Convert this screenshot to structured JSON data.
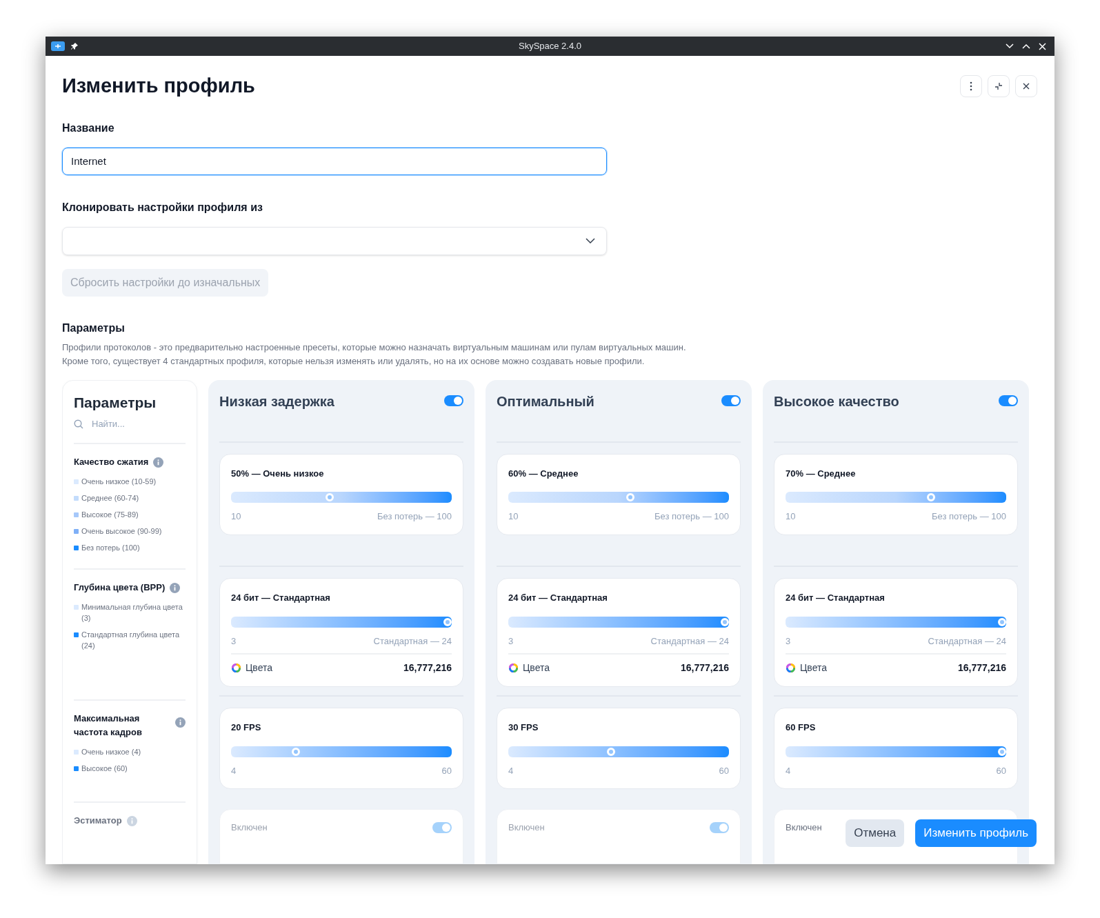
{
  "window": {
    "title": "SkySpace 2.4.0"
  },
  "page": {
    "title": "Изменить профиль"
  },
  "name_field": {
    "label": "Название",
    "value": "Internet",
    "focused": true
  },
  "clone_field": {
    "label": "Клонировать настройки профиля из"
  },
  "reset_button": {
    "label": "Сбросить настройки до изначальных",
    "disabled": true
  },
  "parameters": {
    "title": "Параметры",
    "description": [
      "Профили протоколов - это предварительно настроенные пресеты, которые можно назначать виртуальным машинам или пулам виртуальных машин.",
      "Кроме того, существует 4 стандартных профиля, которые нельзя изменять или удалять, но на их основе можно создавать новые профили."
    ]
  },
  "sidebar": {
    "title": "Параметры",
    "search": {
      "placeholder": "Найти..."
    },
    "groups": [
      {
        "title": "Качество сжатия",
        "disabled": false,
        "items": [
          {
            "label": "Очень низкое (10-59)",
            "color": "#dbeafe"
          },
          {
            "label": "Среднее (60-74)",
            "color": "#c3dcfc"
          },
          {
            "label": "Высокое (75-89)",
            "color": "#a6c8fa"
          },
          {
            "label": "Очень высокое (90-99)",
            "color": "#7fb0f7"
          },
          {
            "label": "Без потерь (100)",
            "color": "#1a8cff"
          }
        ]
      },
      {
        "title": "Глубина цвета (BPP)",
        "disabled": false,
        "items": [
          {
            "label": "Минимальная глубина цвета (3)",
            "color": "#dbeafe"
          },
          {
            "label": "Стандартная глубина цвета (24)",
            "color": "#1a8cff"
          }
        ]
      },
      {
        "title": "Максимальная частота кадров",
        "disabled": false,
        "items": [
          {
            "label": "Очень низкое (4)",
            "color": "#dbeafe"
          },
          {
            "label": "Высокое (60)",
            "color": "#1a8cff"
          }
        ]
      },
      {
        "title": "Эстиматор",
        "disabled": true
      }
    ]
  },
  "profiles": [
    {
      "title": "Низкая задержка",
      "on": true,
      "quality": {
        "label": "50% — Очень низкое",
        "level": 0.444,
        "min": "10",
        "max": "Без потерь — 100"
      },
      "depth": {
        "label": "24 бит — Стандартная",
        "level": 1,
        "min": "3",
        "max": "Стандартная — 24",
        "colors_label": "Цвета",
        "colors_value": "16,777,216"
      },
      "fps": {
        "label": "20 FPS",
        "level": 0.286,
        "min": "4",
        "max": "60"
      },
      "footer": {
        "label": "Включен",
        "on": true,
        "disabled": true
      }
    },
    {
      "title": "Оптимальный",
      "on": true,
      "quality": {
        "label": "60% — Среднее",
        "level": 0.556,
        "min": "10",
        "max": "Без потерь — 100"
      },
      "depth": {
        "label": "24 бит — Стандартная",
        "level": 1,
        "min": "3",
        "max": "Стандартная — 24",
        "colors_label": "Цвета",
        "colors_value": "16,777,216"
      },
      "fps": {
        "label": "30 FPS",
        "level": 0.464,
        "min": "4",
        "max": "60"
      },
      "footer": {
        "label": "Включен",
        "on": true,
        "disabled": true
      }
    },
    {
      "title": "Высокое качество",
      "on": true,
      "quality": {
        "label": "70% — Среднее",
        "level": 0.667,
        "min": "10",
        "max": "Без потерь — 100"
      },
      "depth": {
        "label": "24 бит — Стандартная",
        "level": 1,
        "min": "3",
        "max": "Стандартная — 24",
        "colors_label": "Цвета",
        "colors_value": "16,777,216"
      },
      "fps": {
        "label": "60 FPS",
        "level": 1,
        "min": "4",
        "max": "60"
      },
      "footer": {
        "label": "Включен"
      }
    }
  ],
  "actions": {
    "cancel": "Отмена",
    "submit": "Изменить профиль"
  }
}
